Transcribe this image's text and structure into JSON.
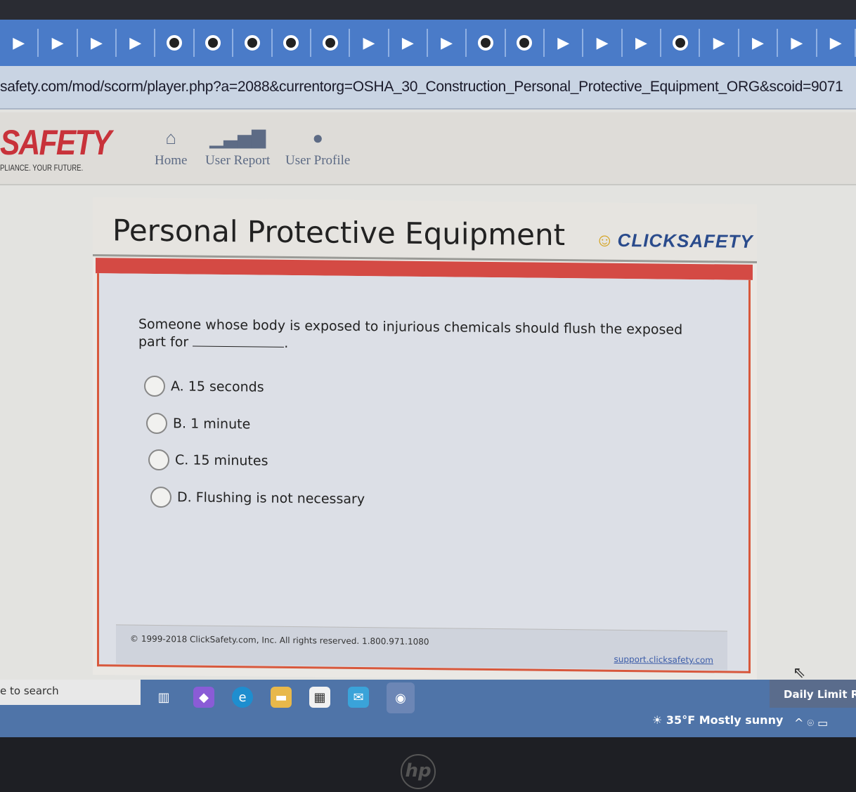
{
  "browser": {
    "tab_icons": [
      "play",
      "play",
      "play",
      "play",
      "circle",
      "circle",
      "circle",
      "circle",
      "circle",
      "play",
      "play",
      "play",
      "circle",
      "circle",
      "play",
      "play",
      "play",
      "circle",
      "play",
      "play",
      "play",
      "play"
    ],
    "url": "safety.com/mod/scorm/player.php?a=2088&currentorg=OSHA_30_Construction_Personal_Protective_Equipment_ORG&scoid=9071"
  },
  "header": {
    "logo": "SAFETY",
    "tagline": "PLIANCE. YOUR FUTURE.",
    "nav": [
      {
        "label": "Home",
        "icon": "home-icon"
      },
      {
        "label": "User Report",
        "icon": "bar-chart-icon"
      },
      {
        "label": "User Profile",
        "icon": "user-icon"
      }
    ]
  },
  "course": {
    "title": "Personal Protective Equipment",
    "brand": "CLICKSAFETY",
    "question": {
      "text_before": "Someone whose body is exposed to injurious chemicals should flush the exposed part for",
      "text_after": "."
    },
    "options": [
      {
        "label": "A. 15 seconds"
      },
      {
        "label": "B. 1 minute"
      },
      {
        "label": "C. 15 minutes"
      },
      {
        "label": "D. Flushing is not necessary"
      }
    ],
    "footer": {
      "copyright": "© 1999-2018 ClickSafety.com, Inc.  All rights reserved.     1.800.971.1080",
      "support_link": "support.clicksafety.com"
    }
  },
  "taskbar": {
    "search_placeholder": "e to search",
    "weather": "35°F  Mostly sunny",
    "daily_limit": "Daily Limit R",
    "tray": "^ ⌾ ▭"
  },
  "device": {
    "brand": "hp"
  }
}
